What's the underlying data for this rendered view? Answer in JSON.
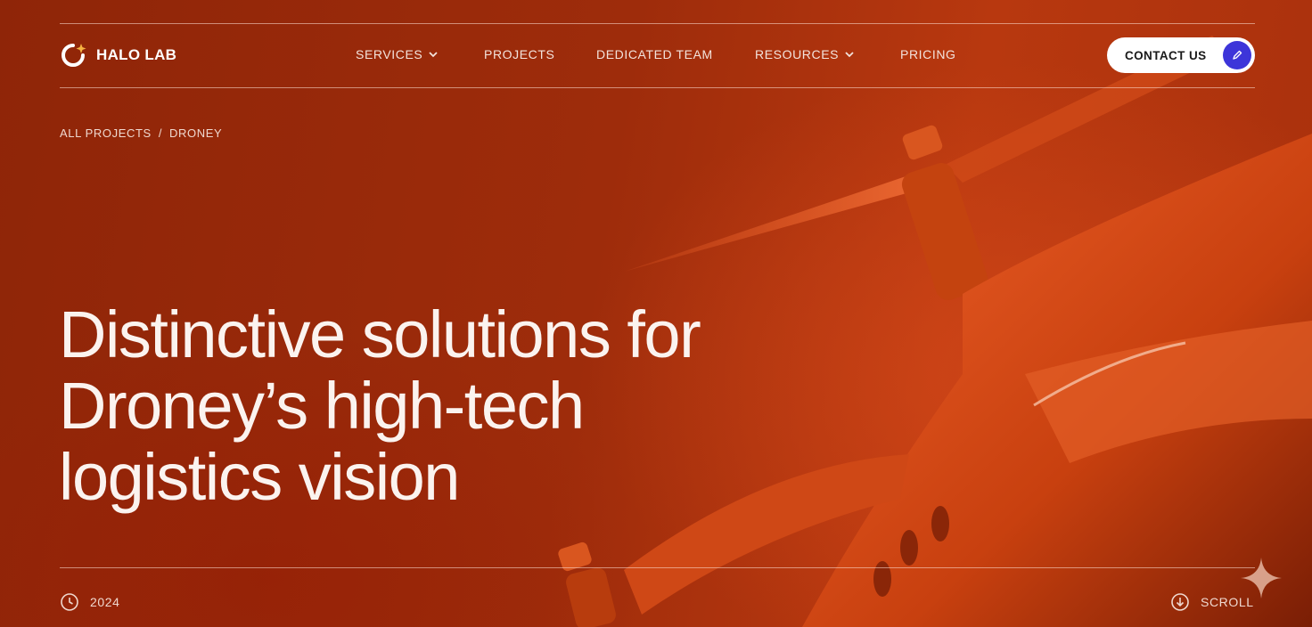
{
  "brand": {
    "name": "HALO LAB",
    "logo_icon": "halo-logo-icon"
  },
  "nav": {
    "items": [
      {
        "label": "SERVICES",
        "has_dropdown": true
      },
      {
        "label": "PROJECTS",
        "has_dropdown": false
      },
      {
        "label": "DEDICATED TEAM",
        "has_dropdown": false
      },
      {
        "label": "RESOURCES",
        "has_dropdown": true
      },
      {
        "label": "PRICING",
        "has_dropdown": false
      }
    ],
    "contact_label": "CONTACT US",
    "contact_icon": "pencil-icon"
  },
  "breadcrumb": {
    "parent": "ALL PROJECTS",
    "separator": "/",
    "current": "DRONEY"
  },
  "hero": {
    "headline_lines": [
      "Distinctive solutions for",
      "Droney’s high-tech",
      "logistics vision"
    ]
  },
  "footer": {
    "year": "2024",
    "year_icon": "clock-icon",
    "scroll_label": "SCROLL",
    "scroll_icon": "arrow-down-circle-icon"
  },
  "colors": {
    "background": "#9e2c0b",
    "accent": "#3d35d9",
    "text": "#fbf3ef"
  }
}
